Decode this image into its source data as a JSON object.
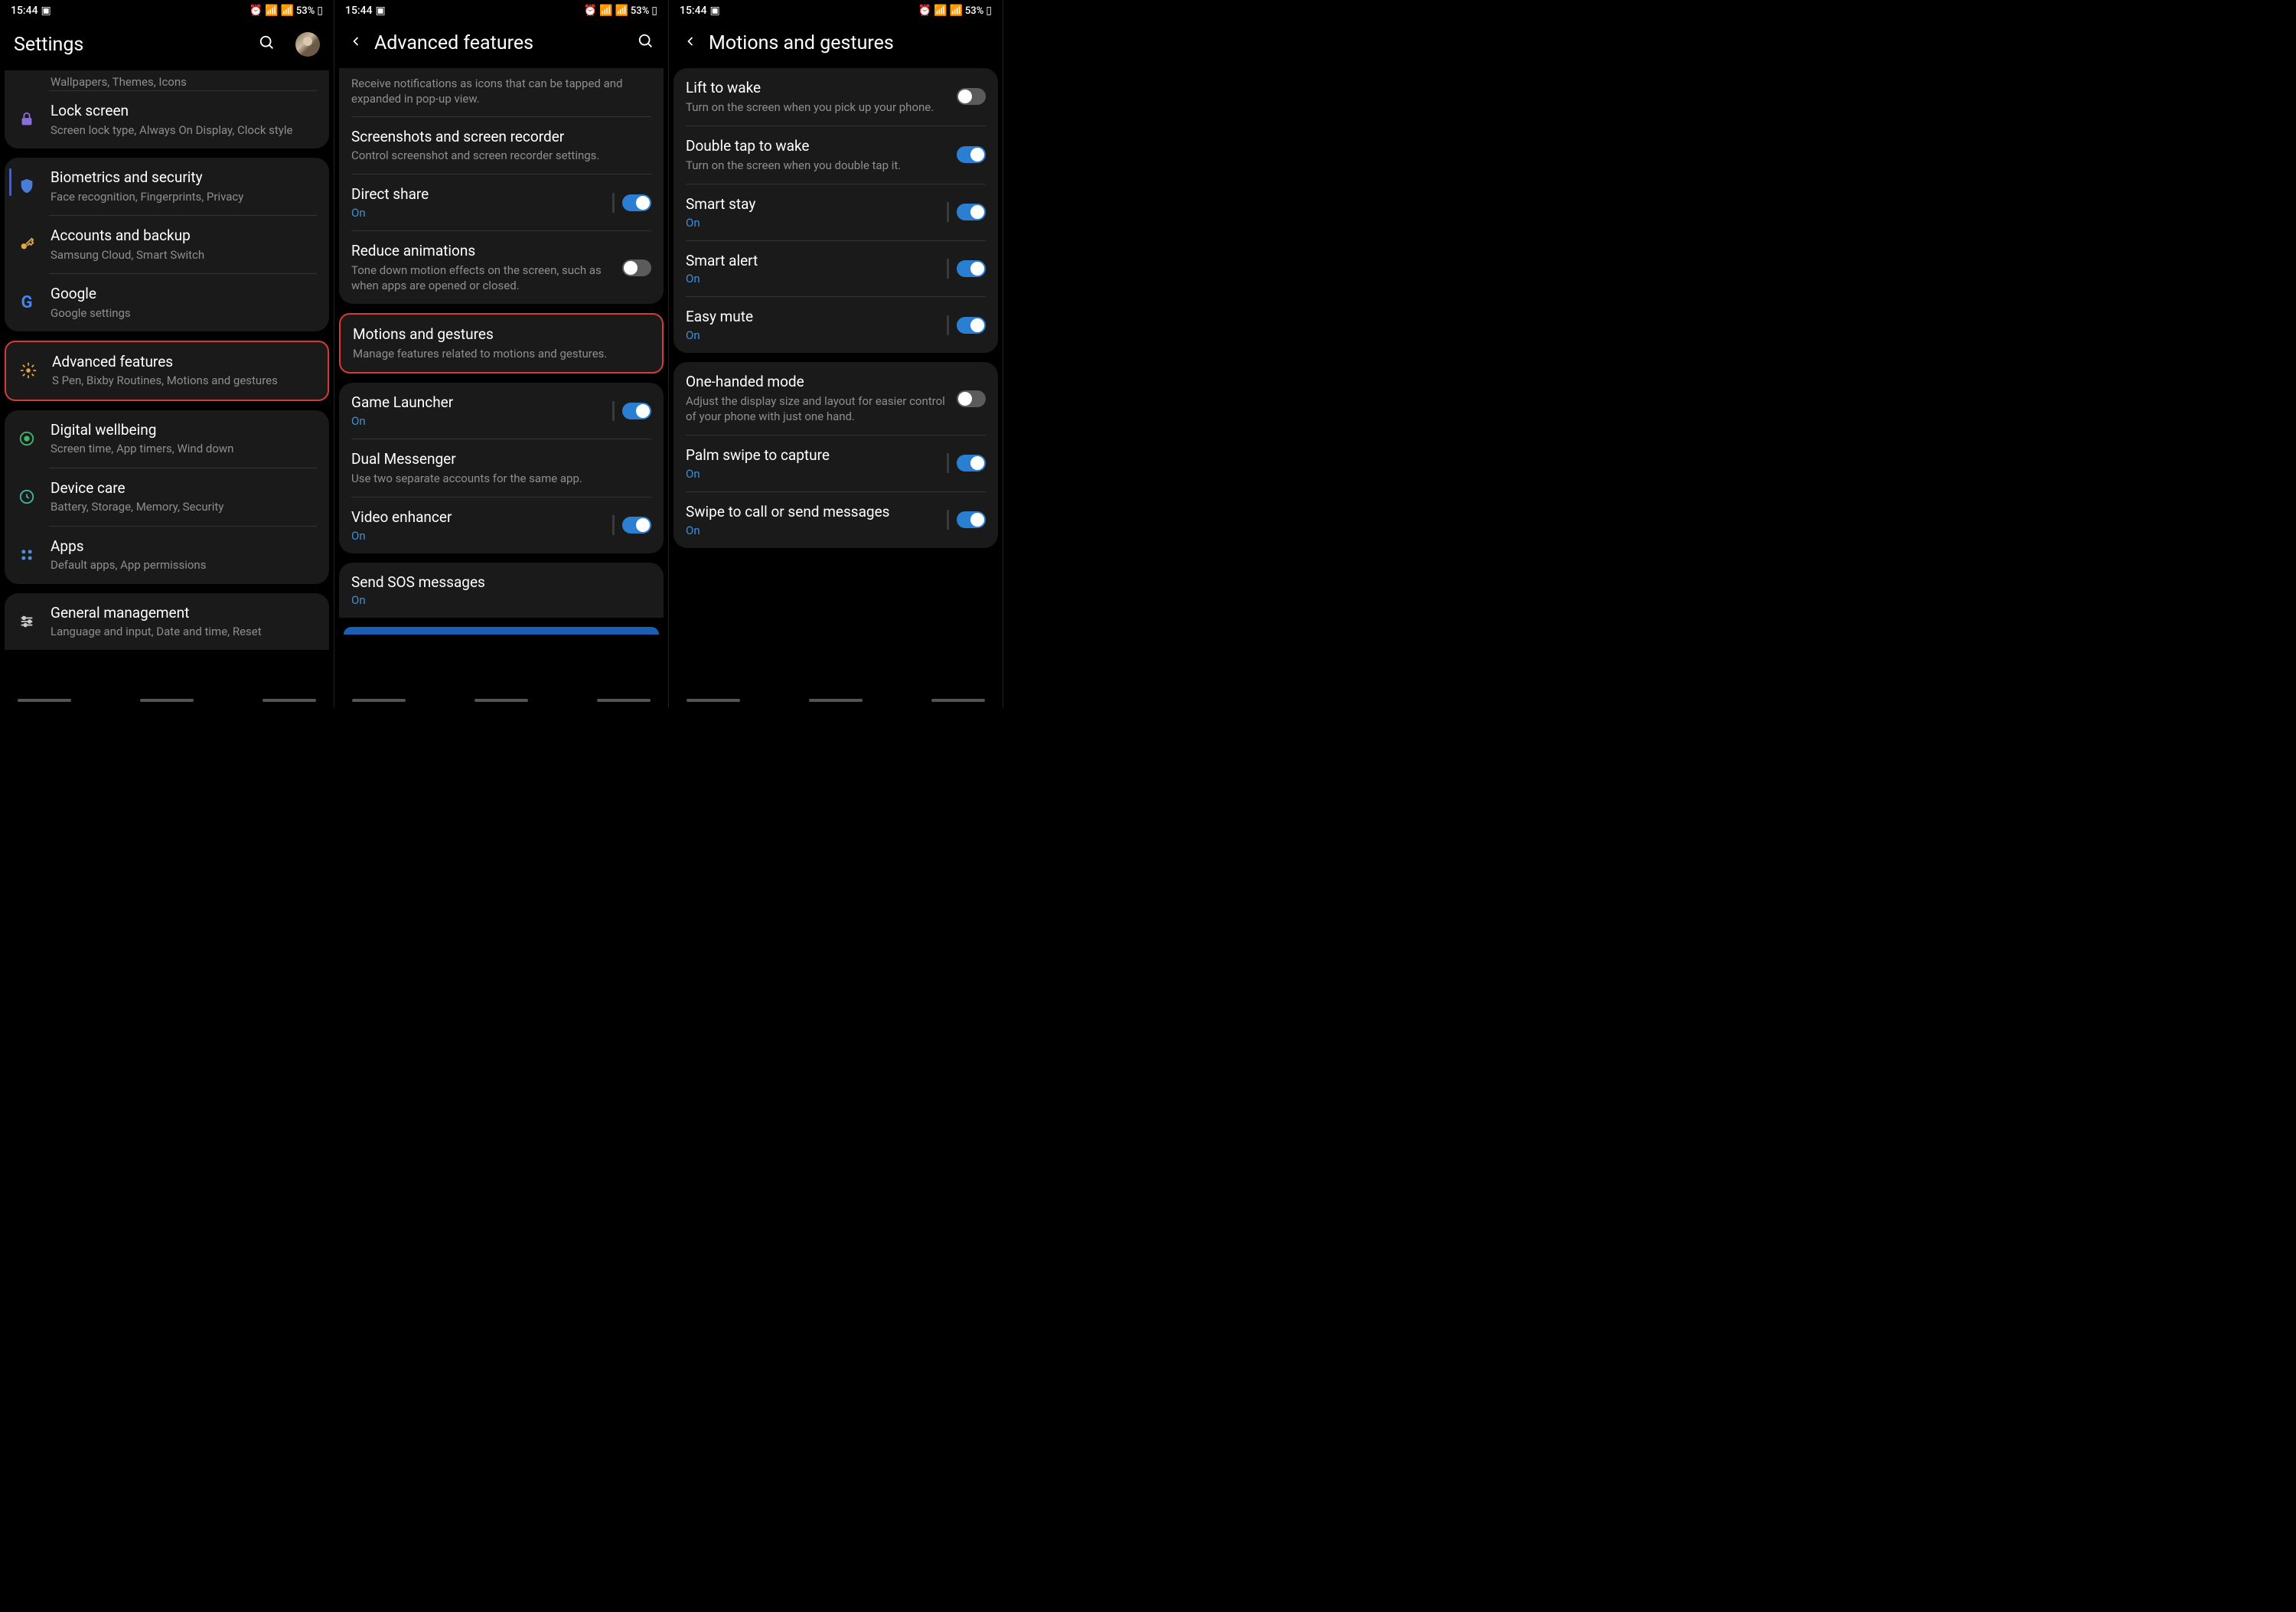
{
  "status": {
    "time": "15:44",
    "battery_pct": "53%"
  },
  "panel1": {
    "title": "Settings",
    "prev_sub": "Wallpapers, Themes, Icons",
    "items": [
      {
        "title": "Lock screen",
        "sub": "Screen lock type, Always On Display, Clock style"
      },
      {
        "title": "Biometrics and security",
        "sub": "Face recognition, Fingerprints, Privacy"
      },
      {
        "title": "Accounts and backup",
        "sub": "Samsung Cloud, Smart Switch"
      },
      {
        "title": "Google",
        "sub": "Google settings"
      },
      {
        "title": "Advanced features",
        "sub": "S Pen, Bixby Routines, Motions and gestures"
      },
      {
        "title": "Digital wellbeing",
        "sub": "Screen time, App timers, Wind down"
      },
      {
        "title": "Device care",
        "sub": "Battery, Storage, Memory, Security"
      },
      {
        "title": "Apps",
        "sub": "Default apps, App permissions"
      },
      {
        "title": "General management",
        "sub": "Language and input, Date and time, Reset"
      }
    ]
  },
  "panel2": {
    "title": "Advanced features",
    "prev_sub": "Receive notifications as icons that can be tapped and expanded in pop-up view.",
    "items": [
      {
        "title": "Screenshots and screen recorder",
        "sub": "Control screenshot and screen recorder settings."
      },
      {
        "title": "Direct share",
        "state": "On",
        "toggle": true
      },
      {
        "title": "Reduce animations",
        "sub": "Tone down motion effects on the screen, such as when apps are opened or closed.",
        "toggle": false
      },
      {
        "title": "Motions and gestures",
        "sub": "Manage features related to motions and gestures."
      },
      {
        "title": "Game Launcher",
        "state": "On",
        "toggle": true
      },
      {
        "title": "Dual Messenger",
        "sub": "Use two separate accounts for the same app."
      },
      {
        "title": "Video enhancer",
        "state": "On",
        "toggle": true
      },
      {
        "title": "Send SOS messages",
        "state": "On"
      }
    ]
  },
  "panel3": {
    "title": "Motions and gestures",
    "items": [
      {
        "title": "Lift to wake",
        "sub": "Turn on the screen when you pick up your phone.",
        "toggle": false
      },
      {
        "title": "Double tap to wake",
        "sub": "Turn on the screen when you double tap it.",
        "toggle": true
      },
      {
        "title": "Smart stay",
        "state": "On",
        "toggle": true
      },
      {
        "title": "Smart alert",
        "state": "On",
        "toggle": true
      },
      {
        "title": "Easy mute",
        "state": "On",
        "toggle": true
      },
      {
        "title": "One-handed mode",
        "sub": "Adjust the display size and layout for easier control of your phone with just one hand.",
        "toggle": false
      },
      {
        "title": "Palm swipe to capture",
        "state": "On",
        "toggle": true
      },
      {
        "title": "Swipe to call or send messages",
        "state": "On",
        "toggle": true
      }
    ]
  }
}
